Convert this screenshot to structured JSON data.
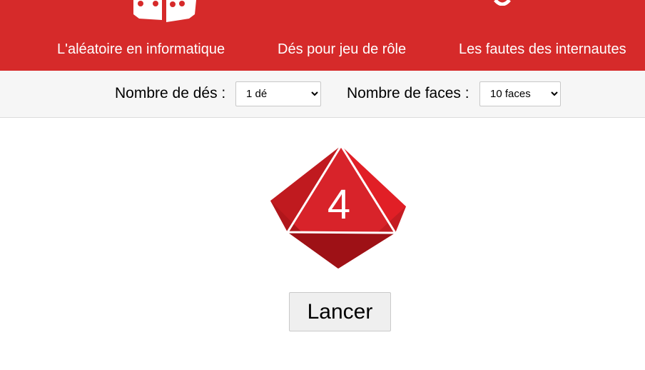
{
  "nav": {
    "items": [
      {
        "label": "L'aléatoire en informatique"
      },
      {
        "label": "Dés pour jeu de rôle"
      },
      {
        "label": "Les fautes des internautes"
      }
    ]
  },
  "controls": {
    "dice_count": {
      "label": "Nombre de dés :",
      "selected": "1 dé"
    },
    "face_count": {
      "label": "Nombre de faces :",
      "selected": "10 faces"
    }
  },
  "die": {
    "value": "4",
    "icon": "d10-die-icon",
    "color": "#d42a2a"
  },
  "roll_button": {
    "label": "Lancer"
  },
  "colors": {
    "header": "#d62a2a",
    "toolbar": "#f6f6f6"
  }
}
